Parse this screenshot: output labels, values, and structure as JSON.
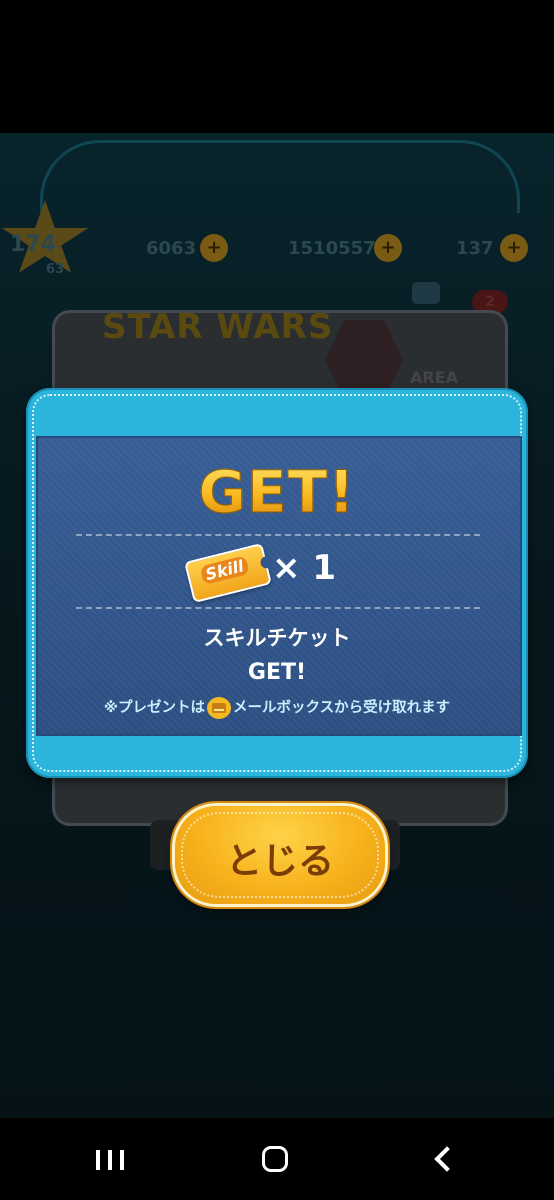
{
  "background": {
    "level": "174",
    "level_sub": "63",
    "coins": "6063",
    "score": "1510557",
    "hearts": "137",
    "logo": "STAR WARS",
    "area_label": "AREA",
    "badge_count": "2"
  },
  "modal": {
    "title": "GET!",
    "item_icon": "skill-ticket",
    "ticket_text": "Skill",
    "quantity": "× 1",
    "item_name": "スキルチケット",
    "item_get": "GET!",
    "note_before": "※プレゼントは",
    "note_after": "メールボックスから受け取れます"
  },
  "close_button": {
    "label": "とじる"
  },
  "colors": {
    "modal_border": "#2bb4dc",
    "modal_panel": "#2f5388",
    "title_gold": "#f6b21c",
    "button_gold": "#f7b21c",
    "button_text": "#7a3d08"
  },
  "nav": {
    "icons": [
      "recent-apps-icon",
      "home-icon",
      "back-icon"
    ]
  }
}
